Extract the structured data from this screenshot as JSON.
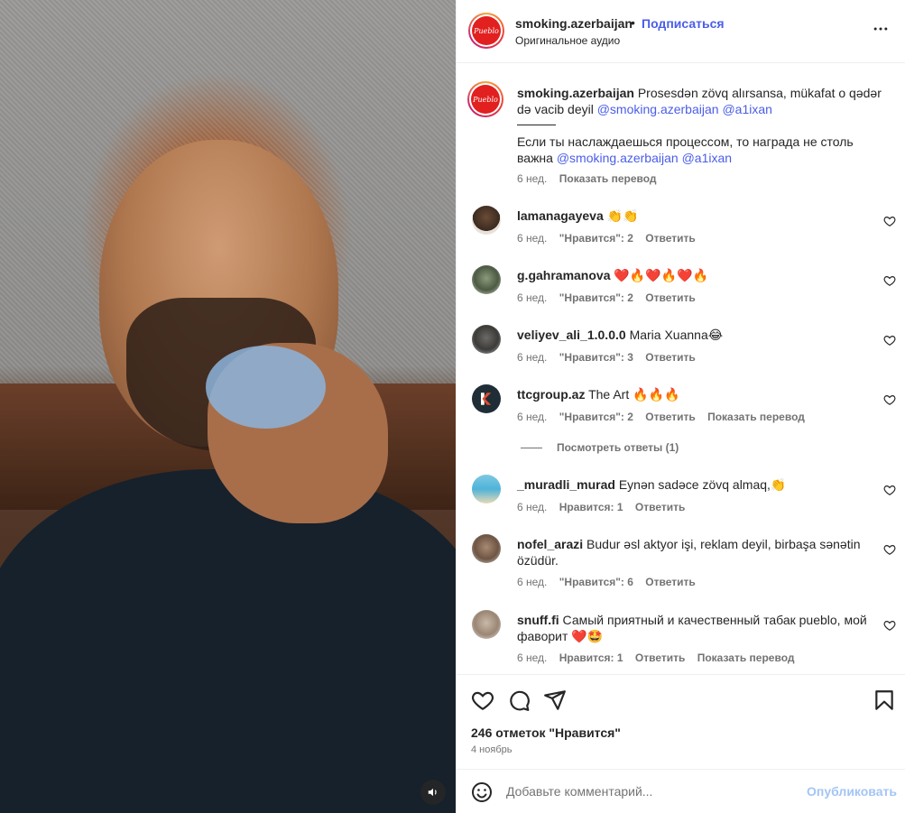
{
  "post": {
    "username": "smoking.azerbaijan",
    "separator": "•",
    "follow_label": "Подписаться",
    "audio": "Оригинальное аудио",
    "more_icon": "more-horizontal-icon",
    "logo_text": "Pueblo"
  },
  "caption": {
    "username": "smoking.azerbaijan",
    "text_az": "Prosesdən zövq alırsansa, mükafat o qədər də vacib deyil",
    "mention1": "@smoking.azerbaijan",
    "mention2": "@a1ixan",
    "text_ru": "Если ты наслаждаешься процессом, то награда не столь важна",
    "mention3": "@smoking.azerbaijan",
    "mention4": "@a1ixan",
    "time": "6 нед.",
    "translate": "Показать перевод"
  },
  "comments": [
    {
      "username": "lamanagayeva",
      "text": "👏👏",
      "time": "6 нед.",
      "likes": "\"Нравится\": 2",
      "reply": "Ответить",
      "translate": ""
    },
    {
      "username": "g.gahramanova",
      "text": "❤️🔥❤️🔥❤️🔥",
      "time": "6 нед.",
      "likes": "\"Нравится\": 2",
      "reply": "Ответить",
      "translate": ""
    },
    {
      "username": "veliyev_ali_1.0.0.0",
      "text": "Maria Xuanna😂",
      "time": "6 нед.",
      "likes": "\"Нравится\": 3",
      "reply": "Ответить",
      "translate": ""
    },
    {
      "username": "ttcgroup.az",
      "text": "The Art 🔥🔥🔥",
      "time": "6 нед.",
      "likes": "\"Нравится\": 2",
      "reply": "Ответить",
      "translate": "Показать перевод"
    },
    {
      "username": "_muradli_murad",
      "text": "Eynən sadəce zövq almaq,👏",
      "time": "6 нед.",
      "likes": "Нравится: 1",
      "reply": "Ответить",
      "translate": ""
    },
    {
      "username": "nofel_arazi",
      "text": "Budur əsl aktyor işi, reklam deyil, birbaşa sənətin özüdür.",
      "time": "6 нед.",
      "likes": "\"Нравится\": 6",
      "reply": "Ответить",
      "translate": ""
    },
    {
      "username": "snuff.fi",
      "text": "Самый приятный и качественный табак pueblo, мой фаворит ❤️🤩",
      "time": "6 нед.",
      "likes": "Нравится: 1",
      "reply": "Ответить",
      "translate": "Показать перевод"
    }
  ],
  "view_replies": "Посмотреть ответы (1)",
  "actions": {
    "likes_count": "246 отметок \"Нравится\"",
    "date": "4 ноябрь"
  },
  "composer": {
    "placeholder": "Добавьте комментарий...",
    "publish": "Опубликовать"
  },
  "colors": {
    "accent": "#4a5de8",
    "publish_disabled": "#a3c5f5",
    "muted": "#737373",
    "brand_red": "#e1201f"
  }
}
